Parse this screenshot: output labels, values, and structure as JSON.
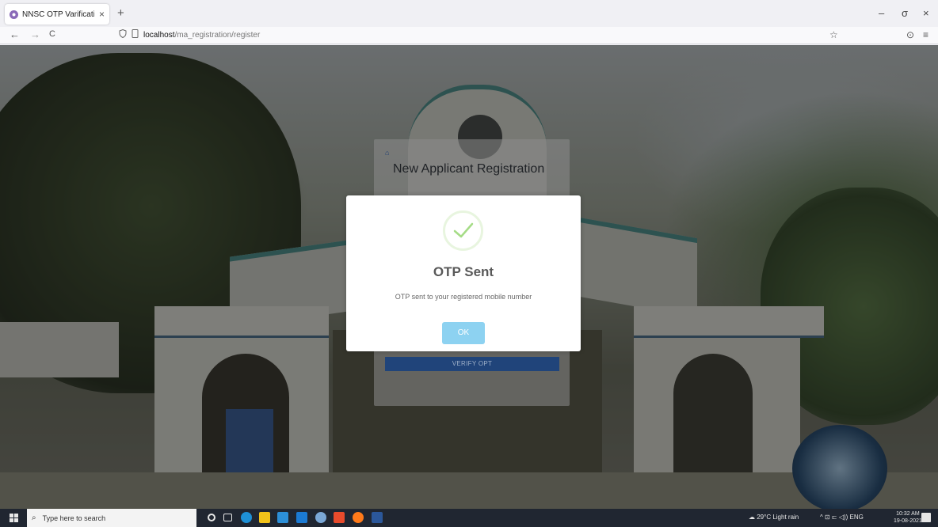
{
  "browser": {
    "tab_title": "NNSC OTP Varification",
    "tab_close": "×",
    "new_tab": "+",
    "url_host": "localhost",
    "url_path": "/ma_registration/register",
    "nav_back": "←",
    "nav_forward": "→",
    "nav_reload": "C",
    "bookmark_star": "☆",
    "window_minimize": "–",
    "window_maximize": "σ",
    "window_close": "×",
    "pocket": "⊙",
    "menu": "≡"
  },
  "registration": {
    "home_icon": "⌂",
    "title": "New Applicant Registration",
    "verify_button": "VERIFY OPT"
  },
  "modal": {
    "icon": "success-check-icon",
    "title": "OTP Sent",
    "message": "OTP sent to your registered mobile number",
    "ok_button": "OK",
    "accent": "#8dd2f1",
    "check_color": "#a5dc86"
  },
  "taskbar": {
    "search_placeholder": "Type here to search",
    "search_icon": "⌕",
    "weather": "29°C  Light rain",
    "tray_icons": "^ ⊡ ⊏ ◁)) ENG",
    "time": "10:32 AM",
    "date": "19-08-2021"
  }
}
